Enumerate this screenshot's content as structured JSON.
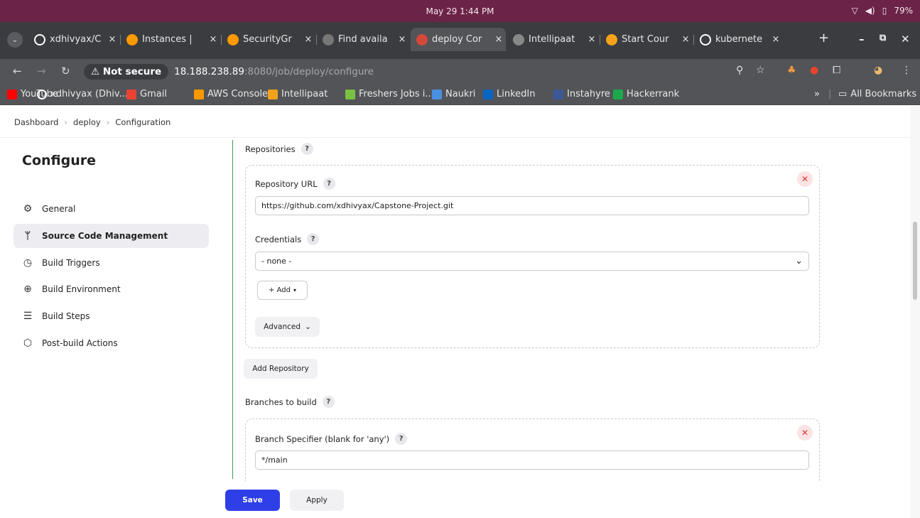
{
  "os": {
    "clock": "May 29  1:44 PM",
    "battery": "79%"
  },
  "tabs": [
    {
      "title": "xdhivyax/C",
      "icon": "github-icon",
      "color": "#ffffff"
    },
    {
      "title": "Instances |",
      "icon": "aws-icon",
      "color": "#ff9900"
    },
    {
      "title": "SecurityGr",
      "icon": "aws-icon",
      "color": "#ff9900"
    },
    {
      "title": "Find availa",
      "icon": "find-icon",
      "color": "#777777"
    },
    {
      "title": "deploy Cor",
      "icon": "jenkins-icon",
      "color": "#d24939"
    },
    {
      "title": "Intellipaat",
      "icon": "globe-icon",
      "color": "#888888"
    },
    {
      "title": "Start Cour",
      "icon": "intellipaat-icon",
      "color": "#f7a21b"
    },
    {
      "title": "kubernete",
      "icon": "github-icon",
      "color": "#ffffff"
    }
  ],
  "omnibox": {
    "security": "Not secure",
    "host": "18.188.238.89",
    "path": ":8080/job/deploy/configure"
  },
  "bookmarks": [
    {
      "label": "YouTube",
      "color": "#ff0000"
    },
    {
      "label": "xdhivyax (Dhiv...",
      "color": "#ffffff"
    },
    {
      "label": "Gmail",
      "color": "#ea4335"
    },
    {
      "label": "AWS Console",
      "color": "#ff9900"
    },
    {
      "label": "Intellipaat",
      "color": "#f7a21b"
    },
    {
      "label": "Freshers Jobs i...",
      "color": "#7ac143"
    },
    {
      "label": "Naukri",
      "color": "#4a90e2"
    },
    {
      "label": "LinkedIn",
      "color": "#0a66c2"
    },
    {
      "label": "Instahyre",
      "color": "#3b5998"
    },
    {
      "label": "Hackerrank",
      "color": "#1ba94c"
    }
  ],
  "all_bookmarks": "All Bookmarks",
  "breadcrumb": [
    "Dashboard",
    "deploy",
    "Configuration"
  ],
  "sidebar": {
    "title": "Configure",
    "items": [
      {
        "label": "General",
        "icon": "gear-icon"
      },
      {
        "label": "Source Code Management",
        "icon": "git-branch-icon"
      },
      {
        "label": "Build Triggers",
        "icon": "timer-icon"
      },
      {
        "label": "Build Environment",
        "icon": "globe-icon"
      },
      {
        "label": "Build Steps",
        "icon": "list-icon"
      },
      {
        "label": "Post-build Actions",
        "icon": "package-icon"
      }
    ]
  },
  "main": {
    "repositories_label": "Repositories",
    "repo_url_label": "Repository URL",
    "repo_url_value": "https://github.com/xdhivyax/Capstone-Project.git",
    "credentials_label": "Credentials",
    "credentials_value": "- none -",
    "add_label": "+ Add",
    "advanced_label": "Advanced",
    "add_repository_label": "Add Repository",
    "branches_label": "Branches to build",
    "branch_specifier_label": "Branch Specifier (blank for 'any')",
    "branch_value": "*/main",
    "save_label": "Save",
    "apply_label": "Apply"
  }
}
